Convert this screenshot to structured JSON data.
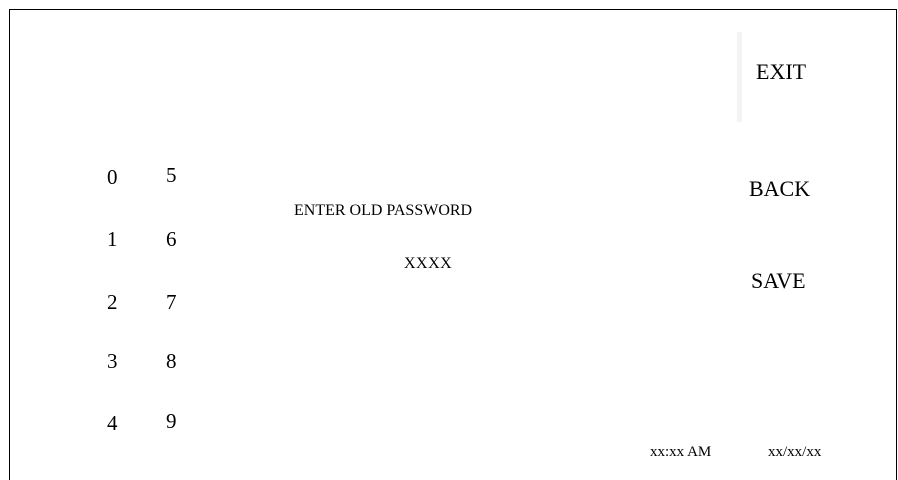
{
  "prompt": "ENTER OLD PASSWORD",
  "password_value": "XXXX",
  "keypad": {
    "left_column": [
      "0",
      "1",
      "2",
      "3",
      "4"
    ],
    "right_column": [
      "5",
      "6",
      "7",
      "8",
      "9"
    ]
  },
  "buttons": {
    "exit": "EXIT",
    "back": "BACK",
    "save": "SAVE"
  },
  "status": {
    "time": "xx:xx AM",
    "date": "xx/xx/xx"
  }
}
